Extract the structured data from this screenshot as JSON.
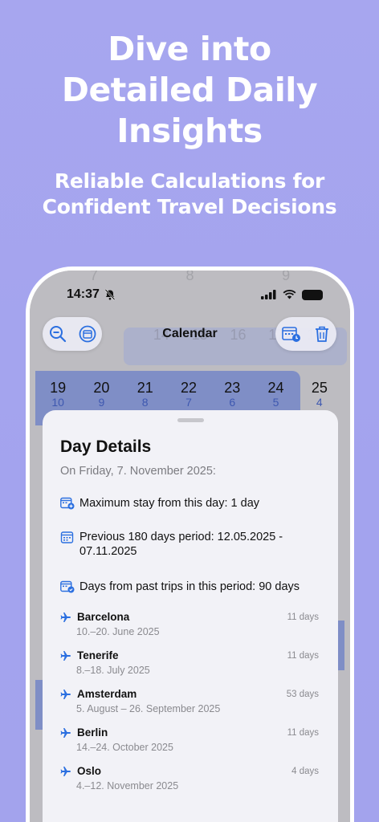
{
  "headline": [
    "Dive into",
    "Detailed Daily",
    "Insights"
  ],
  "subline": [
    "Reliable Calculations for",
    "Confident Travel Decisions"
  ],
  "status_bar": {
    "time": "14:37"
  },
  "nav": {
    "title": "Calendar",
    "left_icons": [
      "zoom-out-icon",
      "calendar-today-icon"
    ],
    "right_icons": [
      "calendar-add-icon",
      "trash-icon"
    ],
    "accent": "#2b6fe0"
  },
  "ghost_weeks": [
    [
      "7",
      "8",
      "9"
    ],
    [
      "14",
      "15",
      "16",
      "17",
      "18"
    ]
  ],
  "calendar_week": [
    {
      "day": "19",
      "count": "10"
    },
    {
      "day": "20",
      "count": "9"
    },
    {
      "day": "21",
      "count": "8"
    },
    {
      "day": "22",
      "count": "7"
    },
    {
      "day": "23",
      "count": "6"
    },
    {
      "day": "24",
      "count": "5"
    },
    {
      "day": "25",
      "count": "4"
    }
  ],
  "sheet": {
    "title": "Day Details",
    "date_line": "On Friday, 7. November 2025:",
    "info": [
      {
        "icon": "calendar-plus-icon",
        "text": "Maximum stay from this day: 1 day"
      },
      {
        "icon": "calendar-icon",
        "text": "Previous 180 days period: 12.05.2025 - 07.11.2025"
      },
      {
        "icon": "calendar-check-icon",
        "text": "Days from past trips in this period: 90 days"
      }
    ],
    "trips": [
      {
        "name": "Barcelona",
        "days": "11 days",
        "range": "10.–20. June 2025"
      },
      {
        "name": "Tenerife",
        "days": "11 days",
        "range": "8.–18. July 2025"
      },
      {
        "name": "Amsterdam",
        "days": "53 days",
        "range": "5. August – 26. September 2025"
      },
      {
        "name": "Berlin",
        "days": "11 days",
        "range": "14.–24. October 2025"
      },
      {
        "name": "Oslo",
        "days": "4 days",
        "range": "4.–12. November 2025"
      }
    ]
  }
}
